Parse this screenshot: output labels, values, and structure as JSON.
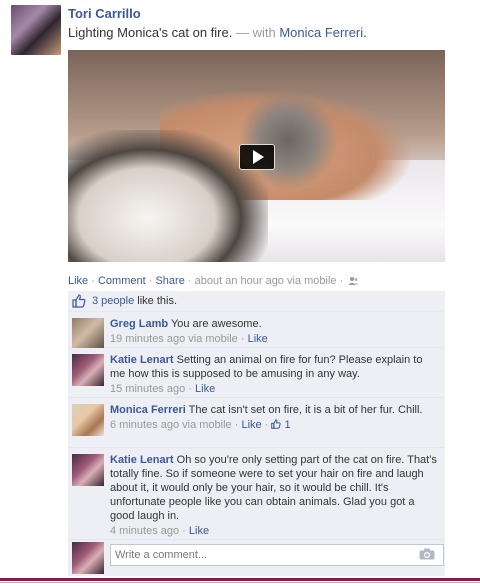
{
  "post": {
    "author": "Tori Carrillo",
    "status": "Lighting Monica's cat on fire.",
    "with_prefix": "— with",
    "tagged": "Monica Ferreri",
    "tagged_suffix": "."
  },
  "actions": {
    "like": "Like",
    "comment": "Comment",
    "share": "Share",
    "separator": "·",
    "time": "about an hour ago via mobile"
  },
  "likes": {
    "count_text": "3 people",
    "suffix": "like this."
  },
  "comments": [
    {
      "author": "Greg Lamb",
      "text": "You are awesome.",
      "time": "19 minutes ago via mobile",
      "like": "Like"
    },
    {
      "author": "Katie Lenart",
      "text": "Setting an animal on fire for fun? Please explain to me how this is supposed to be amusing in any way.",
      "time": "15 minutes ago",
      "like": "Like"
    },
    {
      "author": "Monica Ferreri",
      "text": "The cat isn't set on fire, it is a bit of her fur. Chill.",
      "time": "6 minutes ago via mobile",
      "like": "Like",
      "like_count": "1"
    },
    {
      "author": "Katie Lenart",
      "text": "Oh so you're only setting part of the cat on fire. That's totally fine. So if someone were to set your hair on fire and laugh about it, it would only be your hair, so it would be chill. It's unfortunate people like you can obtain animals. Glad you got a good laugh in.",
      "time": "4 minutes ago",
      "like": "Like"
    }
  ],
  "composer": {
    "placeholder": "Write a comment..."
  },
  "colors": {
    "link": "#3b5998",
    "ufi_bg": "#edeff4",
    "meta": "#999999"
  }
}
